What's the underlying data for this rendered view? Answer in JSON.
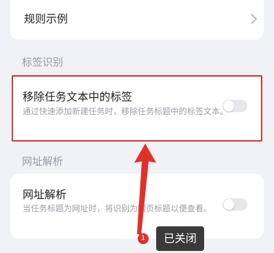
{
  "top": {
    "rules_label": "规则示例"
  },
  "tag_section": {
    "header": "标签识别",
    "item_title": "移除任务文本中的标签",
    "item_desc": "通过快速添加新建任务时，移除任务标题中的标签文本。",
    "toggle_on": false
  },
  "url_section": {
    "header": "网址解析",
    "item_title": "网址解析",
    "item_desc": "当任务标题为网址时，将识别为网页标题以便查看。",
    "toggle_on": false
  },
  "annotation": {
    "badge": "1",
    "status": "已关闭"
  }
}
